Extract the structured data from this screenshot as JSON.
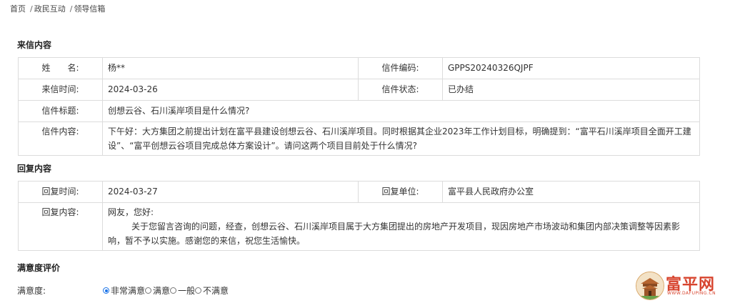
{
  "breadcrumb": [
    "首页",
    "政民互动",
    "领导信箱"
  ],
  "letter": {
    "section_title": "来信内容",
    "name_label": "姓　　名:",
    "name_value": "杨**",
    "code_label": "信件编码:",
    "code_value": "GPPS20240326QJPF",
    "time_label": "来信时间:",
    "time_value": "2024-03-26",
    "status_label": "信件状态:",
    "status_value": "已办结",
    "subject_label": "信件标题:",
    "subject_value": "创想云谷、石川溪岸项目是什么情况?",
    "content_label": "信件内容:",
    "content_value": "下午好：大方集团之前提出计划在富平县建设创想云谷、石川溪岸项目。同时根据其企业2023年工作计划目标，明确提到：“富平石川溪岸项目全面开工建设”、“富平创想云谷项目完成总体方案设计”。请问这两个项目目前处于什么情况?"
  },
  "reply": {
    "section_title": "回复内容",
    "time_label": "回复时间:",
    "time_value": "2024-03-27",
    "unit_label": "回复单位:",
    "unit_value": "富平县人民政府办公室",
    "content_label": "回复内容:",
    "greeting": "网友，您好:",
    "body": "关于您留言咨询的问题，经查，创想云谷、石川溪岸项目属于大方集团提出的房地产开发项目，现因房地产市场波动和集团内部决策调整等因素影响，暂不予以实施。感谢您的来信，祝您生活愉快。"
  },
  "satisfaction": {
    "section_title": "满意度评价",
    "label": "满意度:",
    "options": [
      "非常满意",
      "满意",
      "一般",
      "不满意"
    ],
    "selected": "非常满意"
  },
  "watermark": {
    "text": "富平网",
    "url": "WWW.DAFUPING.CN",
    "color": "#d7442e"
  },
  "colors": {
    "border": "#dcdcdc",
    "radio_accent": "#1a73e8"
  }
}
